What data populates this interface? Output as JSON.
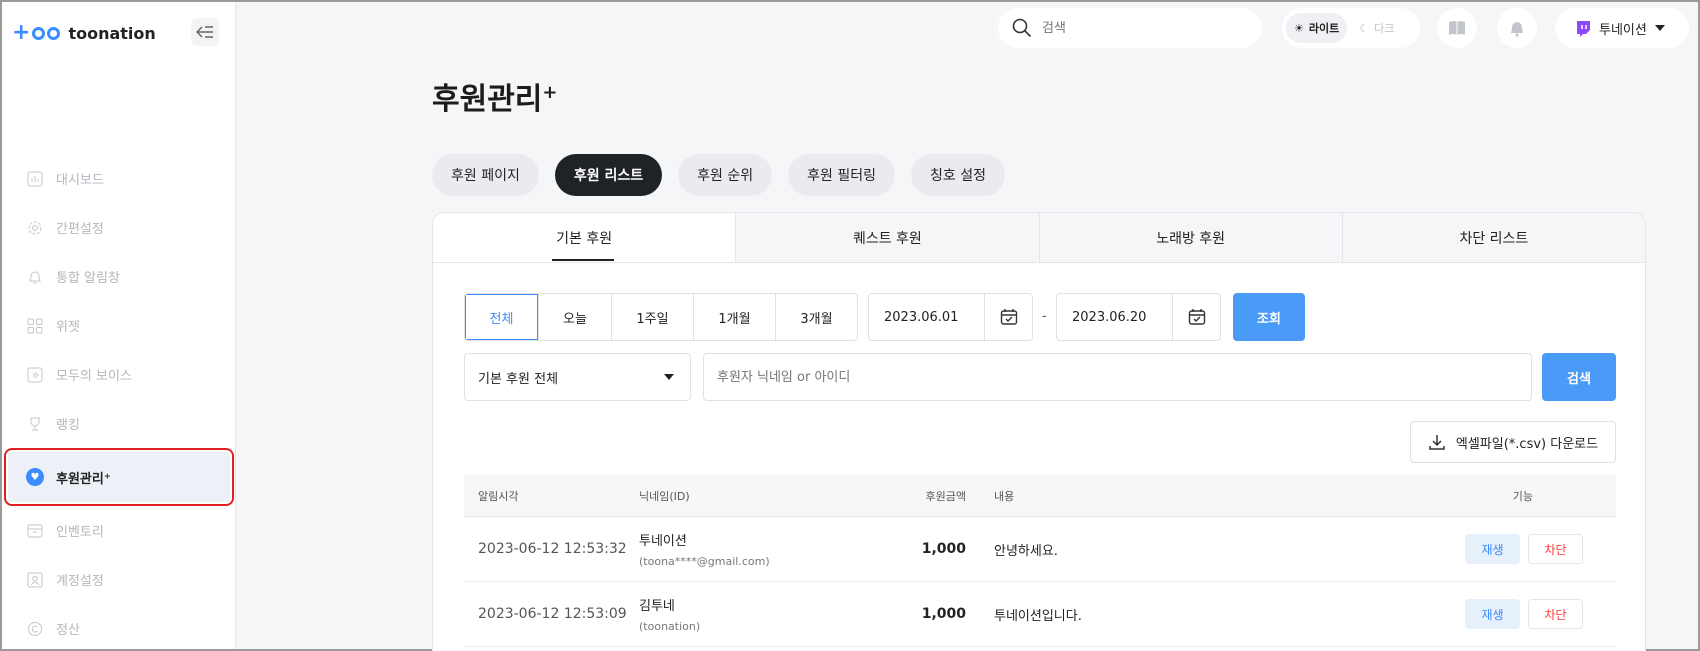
{
  "brand": {
    "name": "toonation"
  },
  "sidebar": {
    "items": [
      {
        "label": "대시보드",
        "icon": "chart-icon"
      },
      {
        "label": "간편설정",
        "icon": "gear-icon"
      },
      {
        "label": "통합 알림창",
        "icon": "bell-icon"
      },
      {
        "label": "위젯",
        "icon": "grid-icon"
      },
      {
        "label": "모두의 보이스",
        "icon": "voice-icon"
      },
      {
        "label": "랭킹",
        "icon": "trophy-icon"
      },
      {
        "label": "후원관리⁺",
        "icon": "heart-icon",
        "active": true
      },
      {
        "label": "인벤토리",
        "icon": "inventory-icon"
      },
      {
        "label": "계정설정",
        "icon": "account-icon"
      },
      {
        "label": "정산",
        "icon": "copyright-icon"
      }
    ]
  },
  "topbar": {
    "search_placeholder": "검색",
    "theme": {
      "light": "라이트",
      "dark": "다크"
    },
    "user": "투네이션"
  },
  "page": {
    "title": "후원관리",
    "title_sup": "+",
    "tabs": [
      "후원 페이지",
      "후원 리스트",
      "후원 순위",
      "후원 필터링",
      "칭호 설정"
    ],
    "active_tab": 1,
    "sub_tabs": [
      "기본 후원",
      "퀘스트 후원",
      "노래방 후원",
      "차단 리스트"
    ]
  },
  "filters": {
    "periods": [
      "전체",
      "오늘",
      "1주일",
      "1개월",
      "3개월"
    ],
    "start_date": "2023.06.01",
    "date_sep": "-",
    "end_date": "2023.06.20",
    "query_btn": "조회",
    "type_select": "기본 후원 전체",
    "search_placeholder": "후원자 닉네임 or 아이디",
    "search_btn": "검색",
    "csv_btn": "엑셀파일(*.csv) 다운로드"
  },
  "table": {
    "headers": {
      "time": "알림시각",
      "nick": "닉네임(ID)",
      "amount": "후원금액",
      "msg": "내용",
      "func": "기능"
    },
    "rows": [
      {
        "time": "2023-06-12 12:53:32",
        "nick": "투네이션",
        "id": "(toona****@gmail.com)",
        "amount": "1,000",
        "msg": "안녕하세요.",
        "play": "재생",
        "block": "차단"
      },
      {
        "time": "2023-06-12 12:53:09",
        "nick": "김투네",
        "id": "(toonation)",
        "amount": "1,000",
        "msg": "투네이션입니다.",
        "play": "재생",
        "block": "차단"
      }
    ]
  },
  "colors": {
    "accent": "#3b8cff",
    "danger": "#ff3b3b",
    "dark_pill": "#1f2226"
  }
}
